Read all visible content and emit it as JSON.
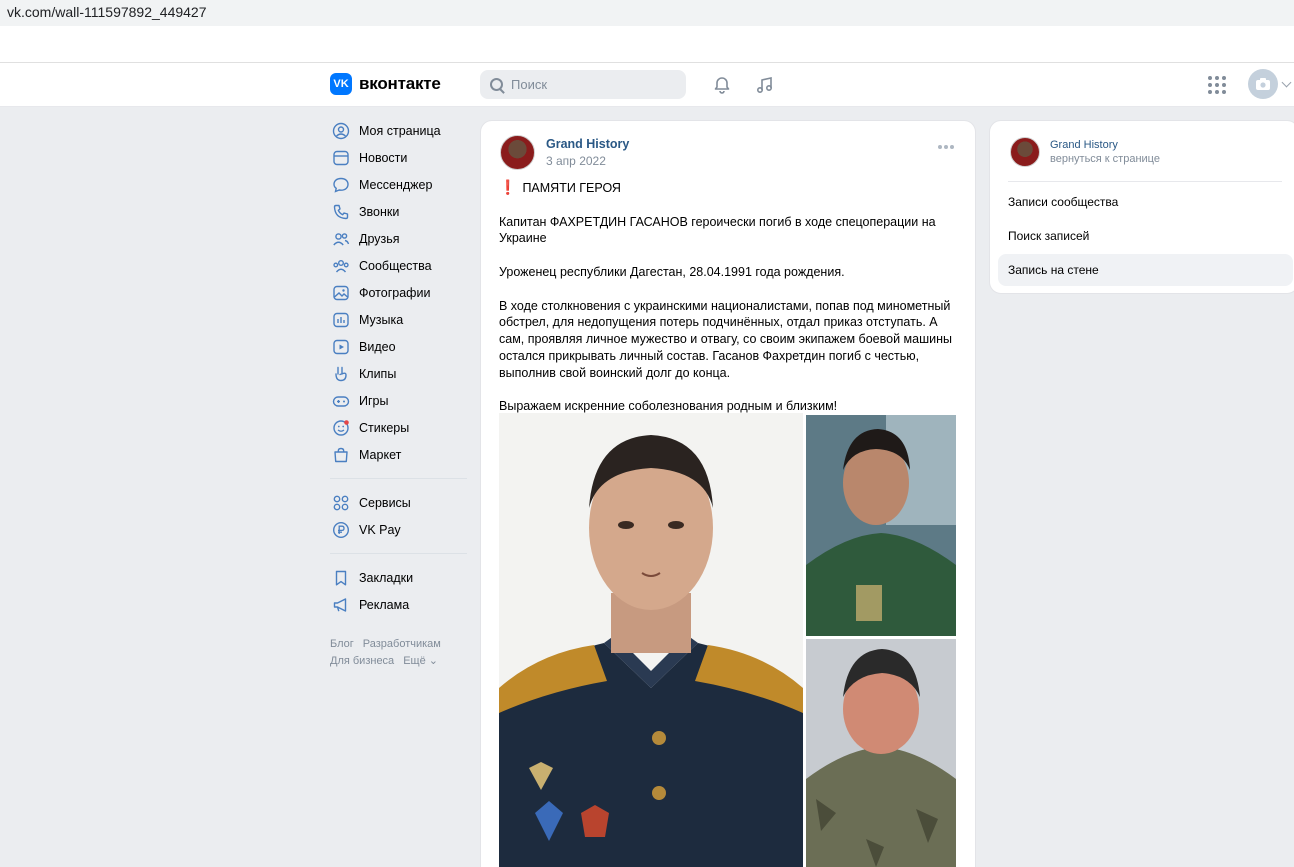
{
  "browser": {
    "url": "vk.com/wall-111597892_449427"
  },
  "header": {
    "logo_text": "вконтакте",
    "logo_mark": "VK",
    "search_placeholder": "Поиск",
    "icons": [
      "search-icon",
      "bell-icon",
      "music-icon",
      "apps-grid-icon",
      "camera-icon",
      "chevron-down-icon"
    ]
  },
  "leftnav": {
    "items": [
      {
        "label": "Моя страница",
        "icon": "user-icon"
      },
      {
        "label": "Новости",
        "icon": "news-icon"
      },
      {
        "label": "Мессенджер",
        "icon": "chat-icon"
      },
      {
        "label": "Звонки",
        "icon": "phone-icon"
      },
      {
        "label": "Друзья",
        "icon": "friends-icon"
      },
      {
        "label": "Сообщества",
        "icon": "communities-icon"
      },
      {
        "label": "Фотографии",
        "icon": "photo-icon"
      },
      {
        "label": "Музыка",
        "icon": "music-icon"
      },
      {
        "label": "Видео",
        "icon": "video-icon"
      },
      {
        "label": "Клипы",
        "icon": "clips-icon"
      },
      {
        "label": "Игры",
        "icon": "gamepad-icon"
      },
      {
        "label": "Стикеры",
        "icon": "sticker-icon"
      },
      {
        "label": "Маркет",
        "icon": "market-icon"
      }
    ],
    "items2": [
      {
        "label": "Сервисы",
        "icon": "services-icon"
      },
      {
        "label": "VK Pay",
        "icon": "vkpay-icon"
      }
    ],
    "items3": [
      {
        "label": "Закладки",
        "icon": "bookmark-icon"
      },
      {
        "label": "Реклама",
        "icon": "ads-icon"
      }
    ],
    "footer": [
      "Блог",
      "Разработчикам",
      "Для бизнеса",
      "Ещё"
    ]
  },
  "post": {
    "author": "Grand History",
    "date": "3 апр 2022",
    "heading": "ПАМЯТИ ГЕРОЯ",
    "p1": "Капитан ФАХРЕТДИН ГАСАНОВ героически погиб в ходе спецоперации на Украине",
    "p2": "Уроженец республики Дагестан, 28.04.1991 года рождения.",
    "p3": "В ходе столкновения с украинскими националистами, попав под минометный обстрел, для недопущения потерь подчинённых, отдал приказ отступать. А сам, проявляя личное мужество и отвагу, со своим экипажем боевой машины остался прикрывать личный состав. Гасанов Фахретдин погиб с честью, выполнив свой воинский долг до конца.",
    "p4": "Выражаем искренние соболезнования родным и близким!"
  },
  "rpanel": {
    "name": "Grand History",
    "back": "вернуться к странице",
    "items": [
      {
        "label": "Записи сообщества"
      },
      {
        "label": "Поиск записей"
      },
      {
        "label": "Запись на стене"
      }
    ]
  },
  "colors": {
    "accent": "#0077ff",
    "link": "#2a5885",
    "muted": "#818c99",
    "background": "#ebedf0"
  }
}
